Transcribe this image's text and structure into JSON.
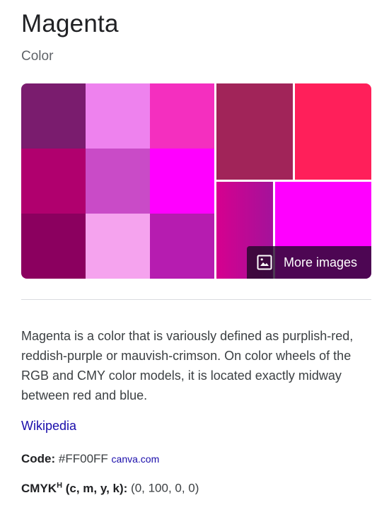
{
  "header": {
    "title": "Magenta",
    "subtitle": "Color"
  },
  "gallery": {
    "more_images_label": "More images",
    "grid_colors": [
      [
        "#7a1c6e",
        "#ee82ee",
        "#f42fbf"
      ],
      [
        "#b0006e",
        "#c94bc7",
        "#ff00ff"
      ],
      [
        "#8b005f",
        "#f5a3ee",
        "#b61cb0"
      ]
    ],
    "image_colors": {
      "top_middle": "#a12459",
      "top_right": "#ff1f5a",
      "bottom_left_start": "#d6008f",
      "bottom_left_end": "#a4129a",
      "bottom_right": "#ff00ff"
    }
  },
  "description": {
    "text": "Magenta is a color that is variously defined as purplish-red, reddish-purple or mauvish-crimson. On color wheels of the RGB and CMY color models, it is located exactly midway between red and blue.",
    "source_link": "Wikipedia"
  },
  "attributes": {
    "code": {
      "key": "Code:",
      "value": "#FF00FF",
      "source": "canva.com"
    },
    "cmyk": {
      "key": "CMYK",
      "key_sup": "H",
      "key_suffix": "(c, m, y, k):",
      "value": "(0, 100, 0, 0)"
    }
  }
}
